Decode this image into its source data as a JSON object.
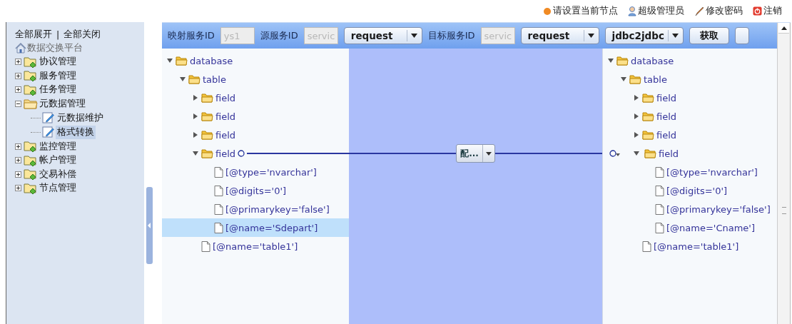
{
  "top_bar": {
    "links": [
      {
        "kind": "dot",
        "label": "请设置当前节点"
      },
      {
        "kind": "user",
        "label": "超级管理员"
      },
      {
        "kind": "pencil",
        "label": "修改密码"
      },
      {
        "kind": "power",
        "label": "注销"
      }
    ]
  },
  "sidebar": {
    "actions": [
      "全部展开",
      "全部关闭"
    ],
    "separator": "|",
    "root": "数据交换平台",
    "items": [
      {
        "label": "协议管理",
        "expanded": false
      },
      {
        "label": "服务管理",
        "expanded": false
      },
      {
        "label": "任务管理",
        "expanded": false
      },
      {
        "label": "元数据管理",
        "expanded": true,
        "children": [
          {
            "label": "元数据维护",
            "selected": false
          },
          {
            "label": "格式转换",
            "selected": true
          }
        ]
      },
      {
        "label": "监控管理",
        "expanded": false
      },
      {
        "label": "帐户管理",
        "expanded": false
      },
      {
        "label": "交易补偿",
        "expanded": false
      },
      {
        "label": "节点管理",
        "expanded": false
      }
    ]
  },
  "toolbar": {
    "items": [
      {
        "kind": "label",
        "text": "映射服务ID"
      },
      {
        "kind": "input",
        "value": "ys1",
        "disabled": true
      },
      {
        "kind": "label",
        "text": "源服务ID"
      },
      {
        "kind": "input",
        "value": "servic",
        "disabled": true
      },
      {
        "kind": "select",
        "value": "request"
      },
      {
        "kind": "label",
        "text": "目标服务ID"
      },
      {
        "kind": "input",
        "value": "servic",
        "disabled": true
      },
      {
        "kind": "select",
        "value": "request"
      },
      {
        "kind": "select",
        "value": "jdbc2jdbc"
      },
      {
        "kind": "button",
        "text": "获取"
      },
      {
        "kind": "button_cut"
      }
    ]
  },
  "source_tree": [
    {
      "kind": "folder",
      "label": "database",
      "expanded": true,
      "children": [
        {
          "kind": "folder",
          "label": "table",
          "expanded": true,
          "children": [
            {
              "kind": "folder",
              "label": "field",
              "expanded": false
            },
            {
              "kind": "folder",
              "label": "field",
              "expanded": false
            },
            {
              "kind": "folder",
              "label": "field",
              "expanded": false
            },
            {
              "kind": "folder",
              "label": "field",
              "expanded": true,
              "mapped": true,
              "children": [
                {
                  "kind": "file",
                  "label": "[@type='nvarchar']",
                  "selected": false
                },
                {
                  "kind": "file",
                  "label": "[@digits='0']",
                  "selected": false
                },
                {
                  "kind": "file",
                  "label": "[@primarykey='false']",
                  "selected": false
                },
                {
                  "kind": "file",
                  "label": "[@name='Sdepart']",
                  "selected": true
                }
              ]
            },
            {
              "kind": "file",
              "label": "[@name='table1']",
              "selected": false
            }
          ]
        }
      ]
    }
  ],
  "mapping": {
    "button_label": "配..."
  },
  "target_tree": [
    {
      "kind": "folder",
      "label": "database",
      "expanded": true,
      "children": [
        {
          "kind": "folder",
          "label": "table",
          "expanded": true,
          "children": [
            {
              "kind": "folder",
              "label": "field",
              "expanded": false
            },
            {
              "kind": "folder",
              "label": "field",
              "expanded": false
            },
            {
              "kind": "folder",
              "label": "field",
              "expanded": false
            },
            {
              "kind": "folder",
              "label": "field",
              "expanded": true,
              "mapped": true,
              "children": [
                {
                  "kind": "file",
                  "label": "[@type='nvarchar']",
                  "selected": false
                },
                {
                  "kind": "file",
                  "label": "[@digits='0']",
                  "selected": false
                },
                {
                  "kind": "file",
                  "label": "[@primarykey='false']",
                  "selected": false
                },
                {
                  "kind": "file",
                  "label": "[@name='Cname']",
                  "selected": false
                }
              ]
            },
            {
              "kind": "file",
              "label": "[@name='table1']",
              "selected": false
            }
          ]
        }
      ]
    }
  ]
}
